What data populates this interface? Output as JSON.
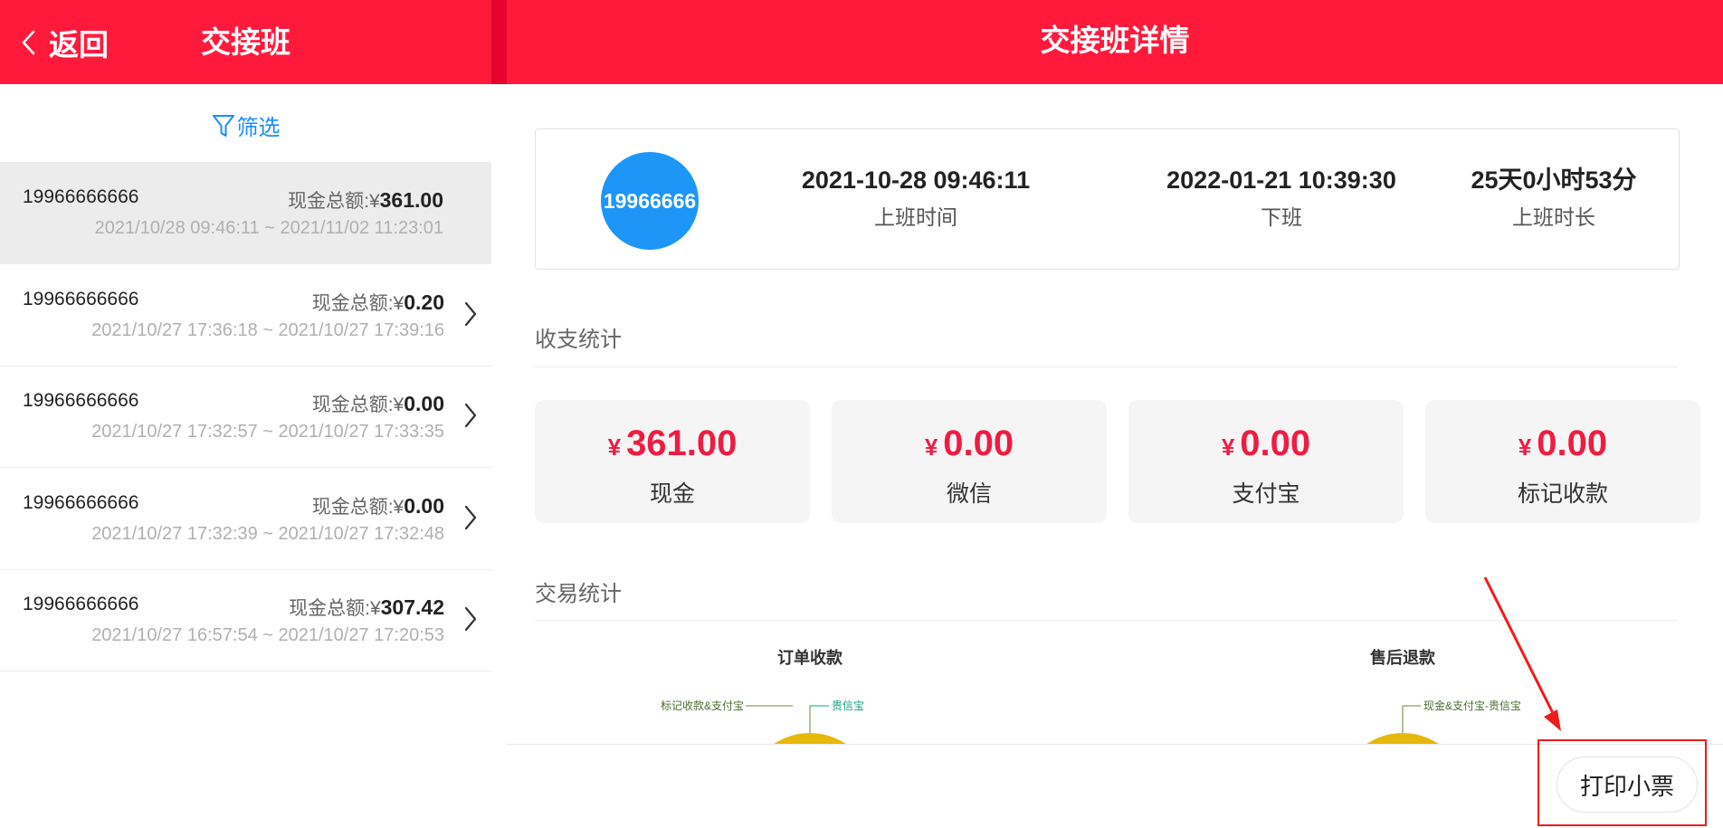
{
  "header": {
    "back_label": "返回",
    "left_title": "交接班",
    "main_title": "交接班详情"
  },
  "filter": {
    "label": "筛选"
  },
  "records": [
    {
      "phone": "19966666666",
      "cash_label": "现金总额:",
      "currency": "¥",
      "amount": "361.00",
      "time": "2021/10/28 09:46:11 ~ 2021/11/02 11:23:01",
      "active": true
    },
    {
      "phone": "19966666666",
      "cash_label": "现金总额:",
      "currency": "¥",
      "amount": "0.20",
      "time": "2021/10/27 17:36:18 ~ 2021/10/27 17:39:16",
      "active": false
    },
    {
      "phone": "19966666666",
      "cash_label": "现金总额:",
      "currency": "¥",
      "amount": "0.00",
      "time": "2021/10/27 17:32:57 ~ 2021/10/27 17:33:35",
      "active": false
    },
    {
      "phone": "19966666666",
      "cash_label": "现金总额:",
      "currency": "¥",
      "amount": "0.00",
      "time": "2021/10/27 17:32:39 ~ 2021/10/27 17:32:48",
      "active": false
    },
    {
      "phone": "19966666666",
      "cash_label": "现金总额:",
      "currency": "¥",
      "amount": "307.42",
      "time": "2021/10/27 16:57:54 ~ 2021/10/27 17:20:53",
      "active": false
    }
  ],
  "detail": {
    "avatar_text": "19966666",
    "start_time": "2021-10-28 09:46:11",
    "start_label": "上班时间",
    "end_time": "2022-01-21 10:39:30",
    "end_label": "下班",
    "duration": "25天0小时53分",
    "duration_label": "上班时长"
  },
  "income_section": {
    "title": "收支统计",
    "stats": [
      {
        "currency": "¥",
        "amount": "361.00",
        "label": "现金"
      },
      {
        "currency": "¥",
        "amount": "0.00",
        "label": "微信"
      },
      {
        "currency": "¥",
        "amount": "0.00",
        "label": "支付宝"
      },
      {
        "currency": "¥",
        "amount": "0.00",
        "label": "标记收款"
      }
    ]
  },
  "trade_section": {
    "title": "交易统计",
    "charts": [
      {
        "title": "订单收款",
        "legend_left": "标记收款&支付宝",
        "legend_right": "贵信宝"
      },
      {
        "title": "售后退款",
        "legend_left": "",
        "legend_right": "现金&支付宝-贵信宝"
      }
    ]
  },
  "print_button": {
    "label": "打印小票"
  },
  "colors": {
    "brand_red": "#ff1a3c",
    "amount_red": "#ef1c42",
    "avatar_blue": "#1e96f7",
    "filter_blue": "#1a8cff",
    "pie_gold": "#e6b80a"
  }
}
